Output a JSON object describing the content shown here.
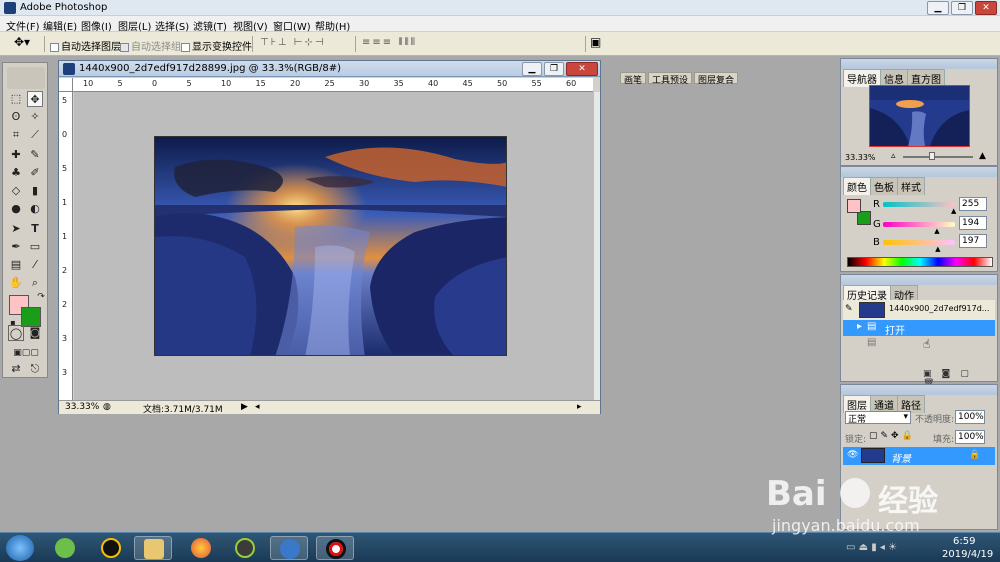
{
  "app": {
    "title": "Adobe Photoshop"
  },
  "menu": [
    "文件(F)",
    "编辑(E)",
    "图像(I)",
    "图层(L)",
    "选择(S)",
    "滤镜(T)",
    "视图(V)",
    "窗口(W)",
    "帮助(H)"
  ],
  "options": {
    "auto_select_layer": "自动选择图层",
    "auto_select_group": "自动选择组",
    "show_transform": "显示变换控件",
    "palette_tabs": [
      "画笔",
      "工具预设",
      "图层复合"
    ]
  },
  "document": {
    "title": "1440x900_2d7edf917d28899.jpg @ 33.3%(RGB/8#)",
    "zoom": "33.33%",
    "doc_size": "文档:3.71M/3.71M",
    "ruler_h": [
      "10",
      "5",
      "0",
      "5",
      "10",
      "15",
      "20",
      "25",
      "30",
      "35",
      "40",
      "45",
      "50",
      "55",
      "60"
    ],
    "ruler_v": [
      "5",
      "0",
      "5",
      "1",
      "1",
      "2",
      "2",
      "3",
      "3"
    ]
  },
  "navigator": {
    "tabs": [
      "导航器",
      "信息",
      "直方图"
    ],
    "zoom": "33.33%"
  },
  "color": {
    "tabs": [
      "颜色",
      "色板",
      "样式"
    ],
    "r_label": "R",
    "g_label": "G",
    "b_label": "B",
    "r": "255",
    "g": "194",
    "b": "197",
    "fg_color": "#ffc2c5",
    "bg_color": "#1a9e1a"
  },
  "history": {
    "tabs": [
      "历史记录",
      "动作"
    ],
    "snapshot": "1440x900_2d7edf917d...",
    "items": [
      "打开"
    ]
  },
  "layers": {
    "tabs": [
      "图层",
      "通道",
      "路径"
    ],
    "blend_mode": "正常",
    "opacity_label": "不透明度:",
    "opacity": "100%",
    "lock_label": "锁定:",
    "fill_label": "填充:",
    "fill": "100%",
    "layer_name": "背景"
  },
  "taskbar": {
    "time": "6:59",
    "date": "2019/4/19"
  },
  "watermark": {
    "brand": "Bai",
    "brand2": "经验",
    "url": "jingyan.baidu.com"
  }
}
